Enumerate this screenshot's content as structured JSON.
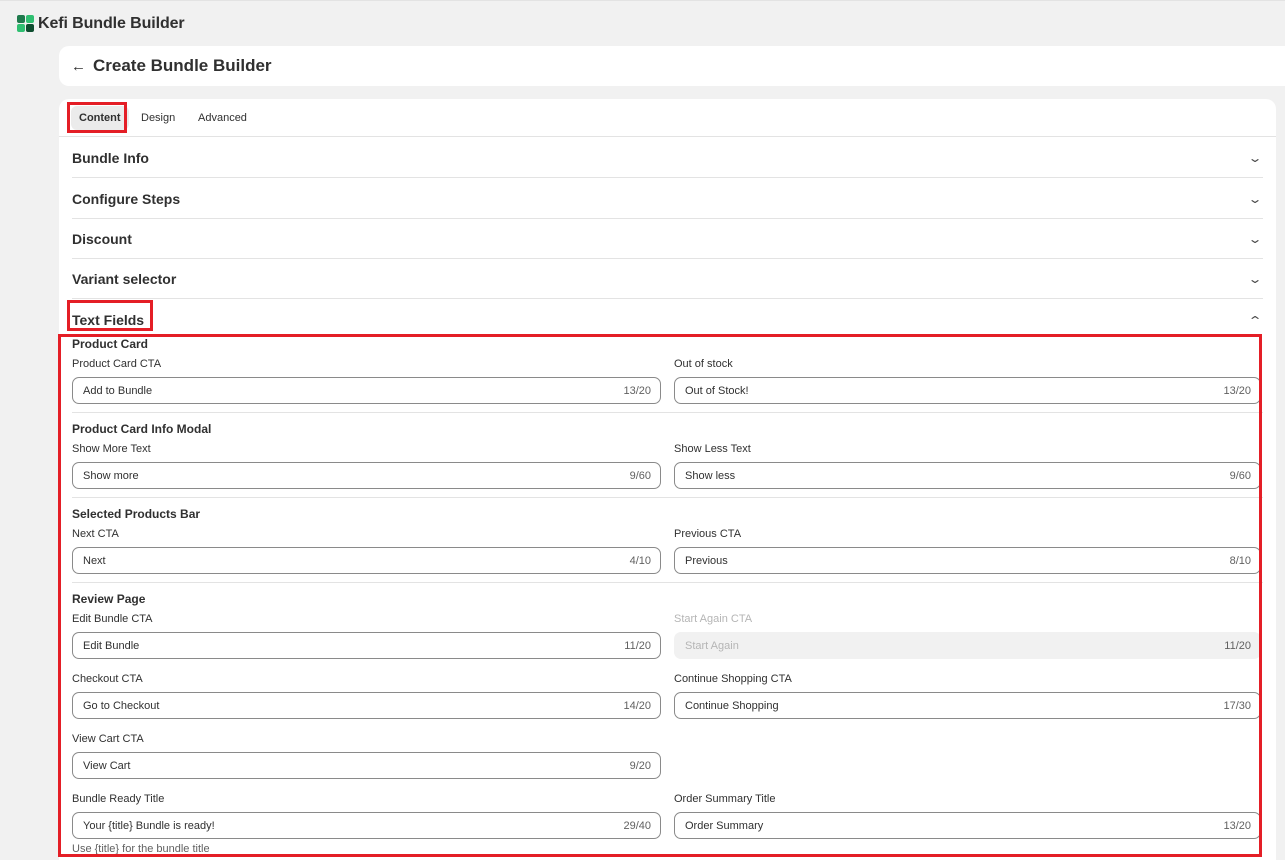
{
  "app": {
    "title": "Kefi Bundle Builder"
  },
  "header": {
    "title": "Create Bundle Builder"
  },
  "tabs": [
    {
      "label": "Content"
    },
    {
      "label": "Design"
    },
    {
      "label": "Advanced"
    }
  ],
  "accordion": [
    {
      "label": "Bundle Info"
    },
    {
      "label": "Configure Steps"
    },
    {
      "label": "Discount"
    },
    {
      "label": "Variant selector"
    },
    {
      "label": "Text Fields"
    }
  ],
  "icons": {
    "back": "arrow-left-icon",
    "collapsed": "chevron-down-icon",
    "expanded": "chevron-up-icon"
  },
  "colors": {
    "highlight": "#e41e26",
    "card": "#ffffff",
    "background": "#f1f1f1"
  },
  "text_fields": {
    "product_card": {
      "title": "Product Card",
      "cta": {
        "label": "Product Card CTA",
        "value": "Add to Bundle",
        "count": "13/20"
      },
      "out_of_stock": {
        "label": "Out of stock",
        "value": "Out of Stock!",
        "count": "13/20"
      }
    },
    "info_modal": {
      "title": "Product Card Info Modal",
      "show_more": {
        "label": "Show More Text",
        "value": "Show more",
        "count": "9/60"
      },
      "show_less": {
        "label": "Show Less Text",
        "value": "Show less",
        "count": "9/60"
      }
    },
    "products_bar": {
      "title": "Selected Products Bar",
      "next": {
        "label": "Next CTA",
        "value": "Next",
        "count": "4/10"
      },
      "previous": {
        "label": "Previous CTA",
        "value": "Previous",
        "count": "8/10"
      }
    },
    "review_page": {
      "title": "Review Page",
      "edit_bundle": {
        "label": "Edit Bundle CTA",
        "value": "Edit Bundle",
        "count": "11/20"
      },
      "start_again": {
        "label": "Start Again CTA",
        "value": "Start Again",
        "count": "11/20"
      },
      "checkout": {
        "label": "Checkout CTA",
        "value": "Go to Checkout",
        "count": "14/20"
      },
      "continue_shopping": {
        "label": "Continue Shopping CTA",
        "value": "Continue Shopping",
        "count": "17/30"
      },
      "view_cart": {
        "label": "View Cart CTA",
        "value": "View Cart",
        "count": "9/20"
      },
      "bundle_ready": {
        "label": "Bundle Ready Title",
        "value": "Your {title} Bundle is ready!",
        "count": "29/40",
        "help": "Use {title} for the bundle title"
      },
      "order_summary": {
        "label": "Order Summary Title",
        "value": "Order Summary",
        "count": "13/20"
      }
    }
  }
}
